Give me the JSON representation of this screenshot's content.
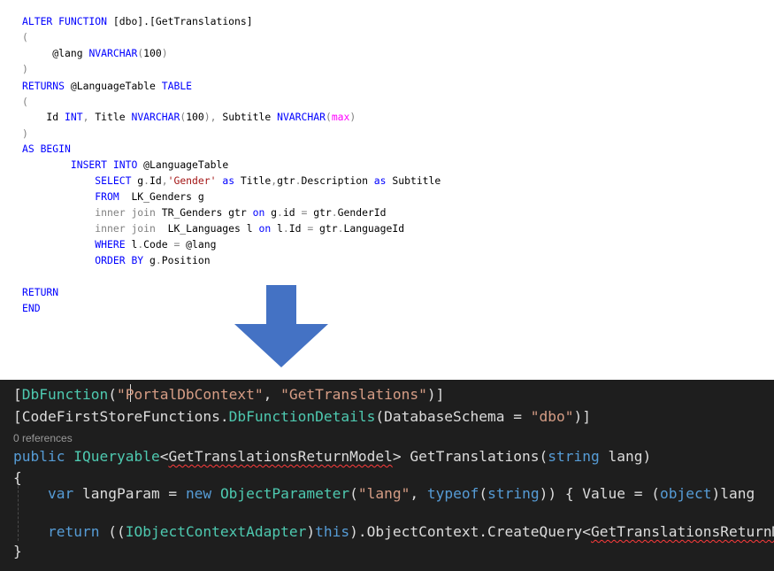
{
  "sql": {
    "lines": [
      [
        {
          "t": "ALTER FUNCTION",
          "c": "k"
        },
        {
          "t": " [dbo].[GetTranslations]",
          "c": "n"
        }
      ],
      [
        {
          "t": "(",
          "c": "g"
        }
      ],
      [
        {
          "t": "     @lang ",
          "c": "n"
        },
        {
          "t": "NVARCHAR",
          "c": "k"
        },
        {
          "t": "(",
          "c": "g"
        },
        {
          "t": "100",
          "c": "n"
        },
        {
          "t": ")",
          "c": "g"
        }
      ],
      [
        {
          "t": ")",
          "c": "g"
        }
      ],
      [
        {
          "t": "RETURNS",
          "c": "k"
        },
        {
          "t": " @LanguageTable ",
          "c": "n"
        },
        {
          "t": "TABLE",
          "c": "k"
        }
      ],
      [
        {
          "t": "(",
          "c": "g"
        }
      ],
      [
        {
          "t": "    Id ",
          "c": "n"
        },
        {
          "t": "INT",
          "c": "k"
        },
        {
          "t": ", ",
          "c": "g"
        },
        {
          "t": "Title ",
          "c": "n"
        },
        {
          "t": "NVARCHAR",
          "c": "k"
        },
        {
          "t": "(",
          "c": "g"
        },
        {
          "t": "100",
          "c": "n"
        },
        {
          "t": "), ",
          "c": "g"
        },
        {
          "t": "Subtitle ",
          "c": "n"
        },
        {
          "t": "NVARCHAR",
          "c": "k"
        },
        {
          "t": "(",
          "c": "g"
        },
        {
          "t": "max",
          "c": "f"
        },
        {
          "t": ")",
          "c": "g"
        }
      ],
      [
        {
          "t": ")",
          "c": "g"
        }
      ],
      [
        {
          "t": "AS BEGIN",
          "c": "k"
        }
      ],
      [
        {
          "t": "        INSERT INTO",
          "c": "k"
        },
        {
          "t": " @LanguageTable",
          "c": "n"
        }
      ],
      [
        {
          "t": "            SELECT",
          "c": "k"
        },
        {
          "t": " g",
          "c": "n"
        },
        {
          "t": ".",
          "c": "g"
        },
        {
          "t": "Id",
          "c": "n"
        },
        {
          "t": ",",
          "c": "g"
        },
        {
          "t": "'Gender'",
          "c": "s"
        },
        {
          "t": " as ",
          "c": "k"
        },
        {
          "t": "Title",
          "c": "n"
        },
        {
          "t": ",",
          "c": "g"
        },
        {
          "t": "gtr",
          "c": "n"
        },
        {
          "t": ".",
          "c": "g"
        },
        {
          "t": "Description",
          "c": "n"
        },
        {
          "t": " as ",
          "c": "k"
        },
        {
          "t": "Subtitle",
          "c": "n"
        }
      ],
      [
        {
          "t": "            FROM",
          "c": "k"
        },
        {
          "t": "  LK_Genders g",
          "c": "n"
        }
      ],
      [
        {
          "t": "            inner join",
          "c": "g"
        },
        {
          "t": " TR_Genders gtr ",
          "c": "n"
        },
        {
          "t": "on",
          "c": "k"
        },
        {
          "t": " g",
          "c": "n"
        },
        {
          "t": ".",
          "c": "g"
        },
        {
          "t": "id ",
          "c": "n"
        },
        {
          "t": "=",
          "c": "g"
        },
        {
          "t": " gtr",
          "c": "n"
        },
        {
          "t": ".",
          "c": "g"
        },
        {
          "t": "GenderId",
          "c": "n"
        }
      ],
      [
        {
          "t": "            inner join",
          "c": "g"
        },
        {
          "t": "  LK_Languages l ",
          "c": "n"
        },
        {
          "t": "on",
          "c": "k"
        },
        {
          "t": " l",
          "c": "n"
        },
        {
          "t": ".",
          "c": "g"
        },
        {
          "t": "Id ",
          "c": "n"
        },
        {
          "t": "=",
          "c": "g"
        },
        {
          "t": " gtr",
          "c": "n"
        },
        {
          "t": ".",
          "c": "g"
        },
        {
          "t": "LanguageId",
          "c": "n"
        }
      ],
      [
        {
          "t": "            WHERE",
          "c": "k"
        },
        {
          "t": " l",
          "c": "n"
        },
        {
          "t": ".",
          "c": "g"
        },
        {
          "t": "Code ",
          "c": "n"
        },
        {
          "t": "=",
          "c": "g"
        },
        {
          "t": " @lang",
          "c": "n"
        }
      ],
      [
        {
          "t": "            ORDER BY",
          "c": "k"
        },
        {
          "t": " g",
          "c": "n"
        },
        {
          "t": ".",
          "c": "g"
        },
        {
          "t": "Position",
          "c": "n"
        }
      ],
      [],
      [
        {
          "t": "RETURN",
          "c": "k"
        }
      ],
      [
        {
          "t": "END",
          "c": "k"
        }
      ]
    ]
  },
  "arrow": {
    "color": "#4472c4"
  },
  "csharp": {
    "codelens": "0 references",
    "lines": [
      [
        {
          "t": "[",
          "c": "cs-txt"
        },
        {
          "t": "DbFunction",
          "c": "cs-type"
        },
        {
          "t": "(",
          "c": "cs-txt"
        },
        {
          "t": "\"PortalDbContext\"",
          "c": "cs-str"
        },
        {
          "t": ", ",
          "c": "cs-txt"
        },
        {
          "t": "\"GetTranslations\"",
          "c": "cs-str"
        },
        {
          "t": ")]",
          "c": "cs-txt"
        }
      ],
      [
        {
          "t": "[CodeFirstStoreFunctions.",
          "c": "cs-txt"
        },
        {
          "t": "DbFunctionDetails",
          "c": "cs-type"
        },
        {
          "t": "(DatabaseSchema = ",
          "c": "cs-txt"
        },
        {
          "t": "\"dbo\"",
          "c": "cs-str"
        },
        {
          "t": ")]",
          "c": "cs-txt"
        }
      ],
      [
        {
          "t": "public ",
          "c": "cs-kw"
        },
        {
          "t": "IQueryable",
          "c": "cs-type"
        },
        {
          "t": "<",
          "c": "cs-txt"
        },
        {
          "t": "GetTranslationsReturnModel",
          "c": "cs-txt",
          "sq": true
        },
        {
          "t": "> GetTranslations(",
          "c": "cs-txt"
        },
        {
          "t": "string",
          "c": "cs-kw"
        },
        {
          "t": " lang)",
          "c": "cs-txt"
        }
      ],
      [
        {
          "t": "{",
          "c": "cs-txt"
        }
      ],
      [
        {
          "t": "    ",
          "c": "cs-txt"
        },
        {
          "t": "var",
          "c": "cs-kw"
        },
        {
          "t": " langParam = ",
          "c": "cs-txt"
        },
        {
          "t": "new",
          "c": "cs-kw"
        },
        {
          "t": " ",
          "c": "cs-txt"
        },
        {
          "t": "ObjectParameter",
          "c": "cs-type"
        },
        {
          "t": "(",
          "c": "cs-txt"
        },
        {
          "t": "\"lang\"",
          "c": "cs-str"
        },
        {
          "t": ", ",
          "c": "cs-txt"
        },
        {
          "t": "typeof",
          "c": "cs-kw"
        },
        {
          "t": "(",
          "c": "cs-txt"
        },
        {
          "t": "string",
          "c": "cs-kw"
        },
        {
          "t": ")) { Value = (",
          "c": "cs-txt"
        },
        {
          "t": "object",
          "c": "cs-kw"
        },
        {
          "t": ")lang",
          "c": "cs-txt"
        }
      ],
      [],
      [
        {
          "t": "    ",
          "c": "cs-txt"
        },
        {
          "t": "return",
          "c": "cs-kw"
        },
        {
          "t": " ((",
          "c": "cs-txt"
        },
        {
          "t": "IObjectContextAdapter",
          "c": "cs-type"
        },
        {
          "t": ")",
          "c": "cs-txt"
        },
        {
          "t": "this",
          "c": "cs-kw"
        },
        {
          "t": ").ObjectContext.CreateQuery<",
          "c": "cs-txt"
        },
        {
          "t": "GetTranslationsReturnModel",
          "c": "cs-txt",
          "sq": true
        }
      ],
      [
        {
          "t": "}",
          "c": "cs-txt"
        }
      ]
    ]
  }
}
